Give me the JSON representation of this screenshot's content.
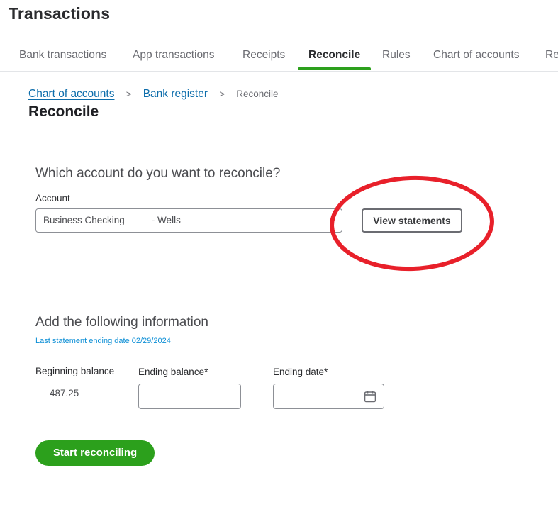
{
  "header": {
    "title": "Transactions"
  },
  "tabs": [
    {
      "label": "Bank transactions",
      "active": false
    },
    {
      "label": "App transactions",
      "active": false
    },
    {
      "label": "Receipts",
      "active": false
    },
    {
      "label": "Reconcile",
      "active": true
    },
    {
      "label": "Rules",
      "active": false
    },
    {
      "label": "Chart of accounts",
      "active": false
    },
    {
      "label": "Re",
      "active": false
    }
  ],
  "breadcrumb": {
    "items": [
      {
        "label": "Chart of accounts"
      },
      {
        "label": "Bank register"
      },
      {
        "label": "Reconcile"
      }
    ],
    "separator": ">"
  },
  "page": {
    "title": "Reconcile"
  },
  "account_section": {
    "heading": "Which account do you want to reconcile?",
    "account_label": "Account",
    "account_value_name": "Business Checking",
    "account_value_suffix": "- Wells",
    "view_statements_label": "View statements"
  },
  "annotation": {
    "type": "ellipse",
    "color": "#e8202a",
    "target": "View statements"
  },
  "info_section": {
    "heading": "Add the following information",
    "last_statement": "Last statement ending date 02/29/2024",
    "beginning_balance_label": "Beginning balance",
    "beginning_balance_value": "487.25",
    "ending_balance_label": "Ending balance*",
    "ending_balance_value": "",
    "ending_date_label": "Ending date*",
    "ending_date_value": "",
    "calendar_icon": "calendar-icon"
  },
  "actions": {
    "start_label": "Start reconciling"
  },
  "colors": {
    "brand_green": "#2ca01c",
    "link_blue": "#0d6dab",
    "info_blue": "#0d8fd6",
    "annotation_red": "#e8202a"
  }
}
